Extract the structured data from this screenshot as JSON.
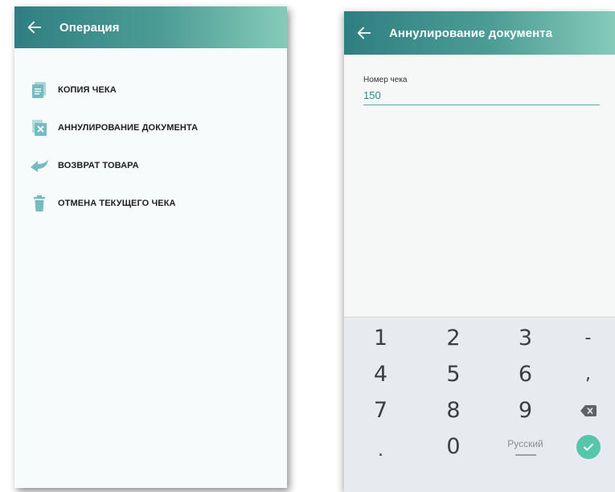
{
  "left_screen": {
    "appbar": {
      "title": "Операция",
      "back_icon": "arrow-left-icon"
    },
    "menu": [
      {
        "id": "receipt-copy",
        "icon": "document-list-icon",
        "label": "КОПИЯ ЧЕКА"
      },
      {
        "id": "document-cancel",
        "icon": "document-cross-icon",
        "label": "АННУЛИРОВАНИЕ ДОКУМЕНТА"
      },
      {
        "id": "return-goods",
        "icon": "return-arrow-icon",
        "label": "ВОЗВРАТ ТОВАРА"
      },
      {
        "id": "cancel-current-receipt",
        "icon": "trash-icon",
        "label": "ОТМЕНА ТЕКУЩЕГО ЧЕКА"
      }
    ]
  },
  "right_screen": {
    "appbar": {
      "title": "Аннулирование документа",
      "back_icon": "arrow-left-icon"
    },
    "field": {
      "label": "Номер чека",
      "value": "150"
    },
    "keyboard": {
      "rows": [
        [
          "1",
          "2",
          "3",
          "-"
        ],
        [
          "4",
          "5",
          "6",
          ","
        ],
        [
          "7",
          "8",
          "9",
          "backspace"
        ],
        [
          ".",
          "0",
          "Русский",
          "done"
        ]
      ],
      "backspace_icon": "backspace-icon",
      "done_icon": "checkmark-icon"
    }
  },
  "colors": {
    "appbar_start": "#2f7f82",
    "appbar_end": "#86cbb8",
    "icon_teal": "#74bcc0",
    "accent_text": "#2a8a8a",
    "done_button": "#56c6a8",
    "keyboard_bg": "#e8ebed"
  }
}
